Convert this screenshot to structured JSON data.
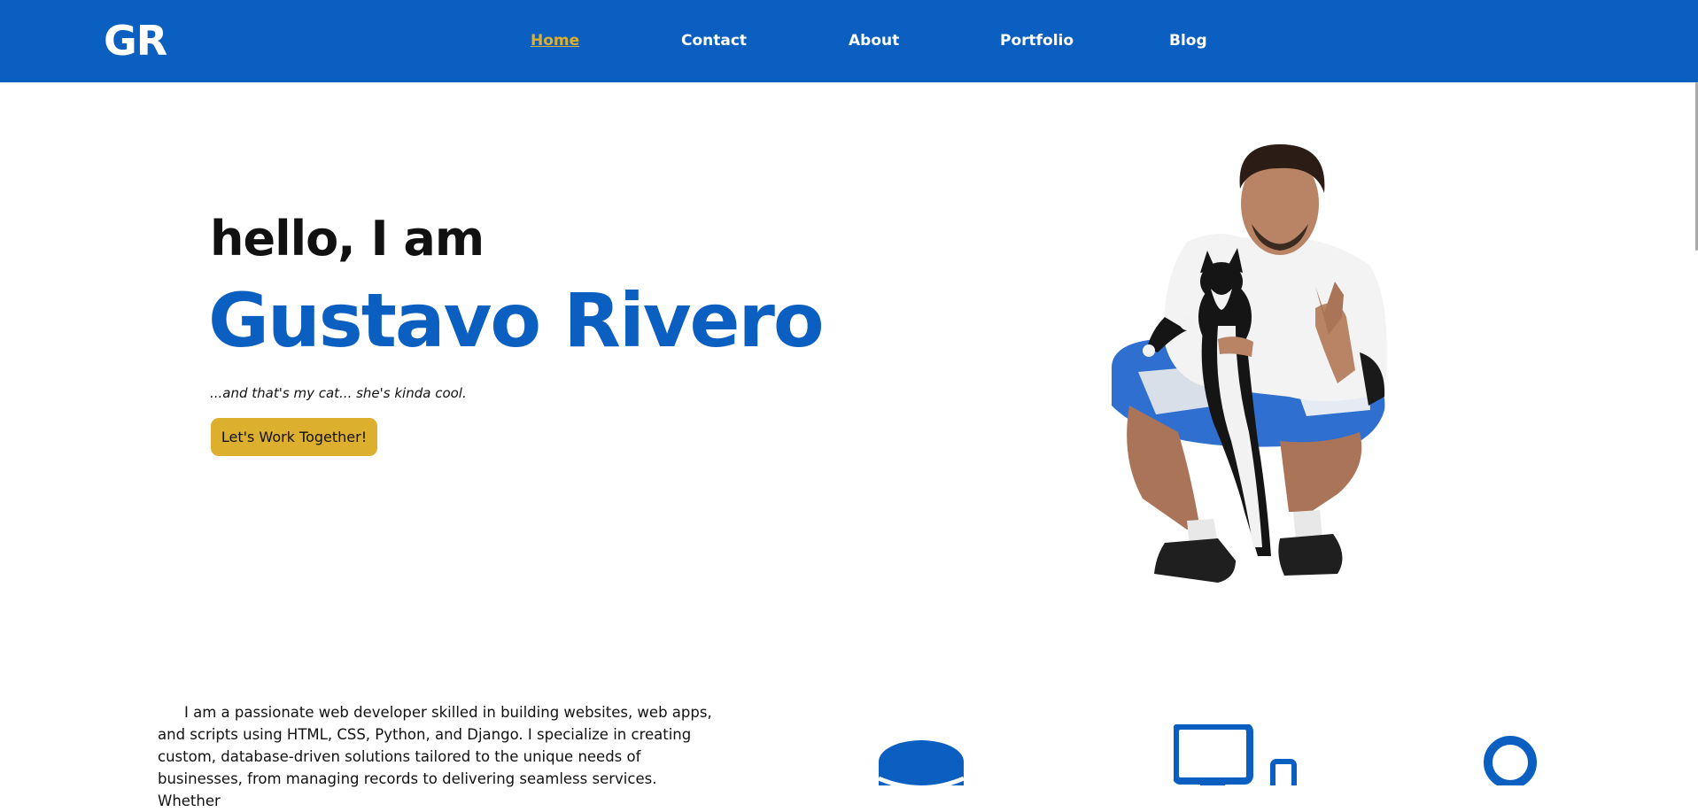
{
  "header": {
    "logo": "GR",
    "nav": [
      {
        "label": "Home",
        "active": true
      },
      {
        "label": "Contact",
        "active": false
      },
      {
        "label": "About",
        "active": false
      },
      {
        "label": "Portfolio",
        "active": false
      },
      {
        "label": "Blog",
        "active": false
      }
    ]
  },
  "hero": {
    "greeting": "hello, I am",
    "name": "Gustavo Rivero",
    "tagline": "...and that's my cat... she's kinda cool.",
    "cta_label": "Let's Work Together!",
    "photo_icon": "person-with-cat-photo"
  },
  "about": {
    "intro_lines": [
      "I am a passionate web developer skilled in building websites, web apps,",
      "and scripts using HTML, CSS, Python, and Django. I specialize in creating",
      "custom, database-driven solutions tailored to the unique needs of",
      "businesses, from managing records to delivering seamless services. Whether"
    ]
  },
  "services": {
    "icons": [
      "database-icon",
      "devices-icon",
      "circle-icon"
    ]
  },
  "colors": {
    "brand_blue": "#0b5fc1",
    "accent_gold": "#ddaf2f",
    "text": "#111111",
    "background": "#ffffff"
  }
}
